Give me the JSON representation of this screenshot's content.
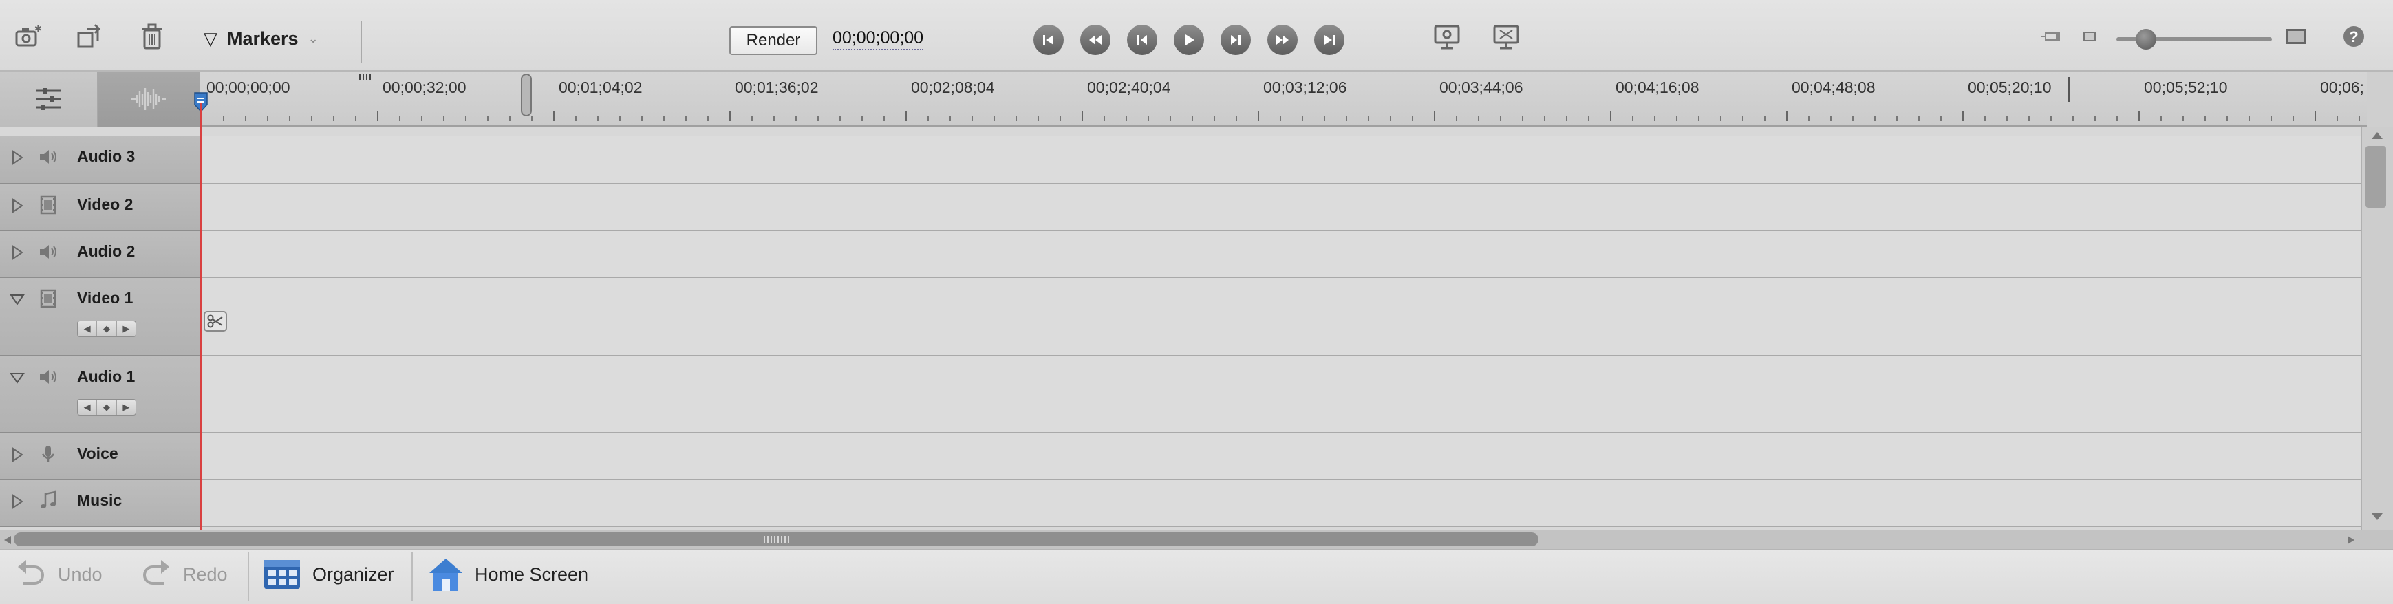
{
  "toolbar": {
    "markers_label": "Markers",
    "render_label": "Render",
    "timecode": "00;00;00;00",
    "icons": [
      "camera-add-icon",
      "rotate-icon",
      "trash-icon",
      "go-to-start-icon",
      "previous-edit-icon",
      "step-back-icon",
      "play-icon",
      "step-forward-icon",
      "next-edit-icon",
      "go-to-end-icon",
      "fit-monitor-icon",
      "fullscreen-monitor-icon",
      "zoom-out-icon",
      "zoom-in-icon",
      "help-icon"
    ],
    "zoom_level": 0.2
  },
  "ruler": {
    "labels": [
      "00;00;00;00",
      "00;00;32;00",
      "00;01;04;02",
      "00;01;36;02",
      "00;02;08;04",
      "00;02;40;04",
      "00;03;12;06",
      "00;03;44;06",
      "00;04;16;08",
      "00;04;48;08",
      "00;05;20;10",
      "00;05;52;10",
      "00;06;"
    ]
  },
  "tracks": [
    {
      "name": "Audio 3",
      "type": "audio",
      "expanded": false
    },
    {
      "name": "Video 2",
      "type": "video",
      "expanded": false
    },
    {
      "name": "Audio 2",
      "type": "audio",
      "expanded": false
    },
    {
      "name": "Video 1",
      "type": "video",
      "expanded": true
    },
    {
      "name": "Audio 1",
      "type": "audio",
      "expanded": true
    },
    {
      "name": "Voice",
      "type": "voice",
      "expanded": false
    },
    {
      "name": "Music",
      "type": "music",
      "expanded": false
    }
  ],
  "bottombar": {
    "undo_label": "Undo",
    "redo_label": "Redo",
    "organizer_label": "Organizer",
    "home_label": "Home Screen"
  },
  "colors": {
    "playhead": "#d94040",
    "accent": "#3a7bc8"
  }
}
